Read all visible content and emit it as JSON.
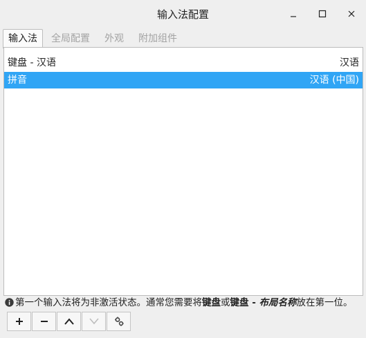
{
  "window": {
    "title": "输入法配置"
  },
  "tabs": [
    {
      "label": "输入法",
      "active": true
    },
    {
      "label": "全局配置",
      "active": false
    },
    {
      "label": "外观",
      "active": false
    },
    {
      "label": "附加组件",
      "active": false
    }
  ],
  "list": {
    "header": {
      "name": "键盘 - 汉语",
      "lang": "汉语"
    },
    "selected": {
      "name": "拼音",
      "lang": "汉语 (中国)"
    }
  },
  "info": {
    "part1": "第一个输入法将为非激活状态。通常您需要将",
    "bold1": "键盘",
    "part2": "或",
    "bold2": "键盘 - ",
    "italic": "布局名称",
    "part3": "放在第一位。"
  },
  "toolbar": {
    "icons": [
      "plus-icon",
      "minus-icon",
      "chevron-up-icon",
      "chevron-down-icon",
      "gear-icon"
    ]
  }
}
